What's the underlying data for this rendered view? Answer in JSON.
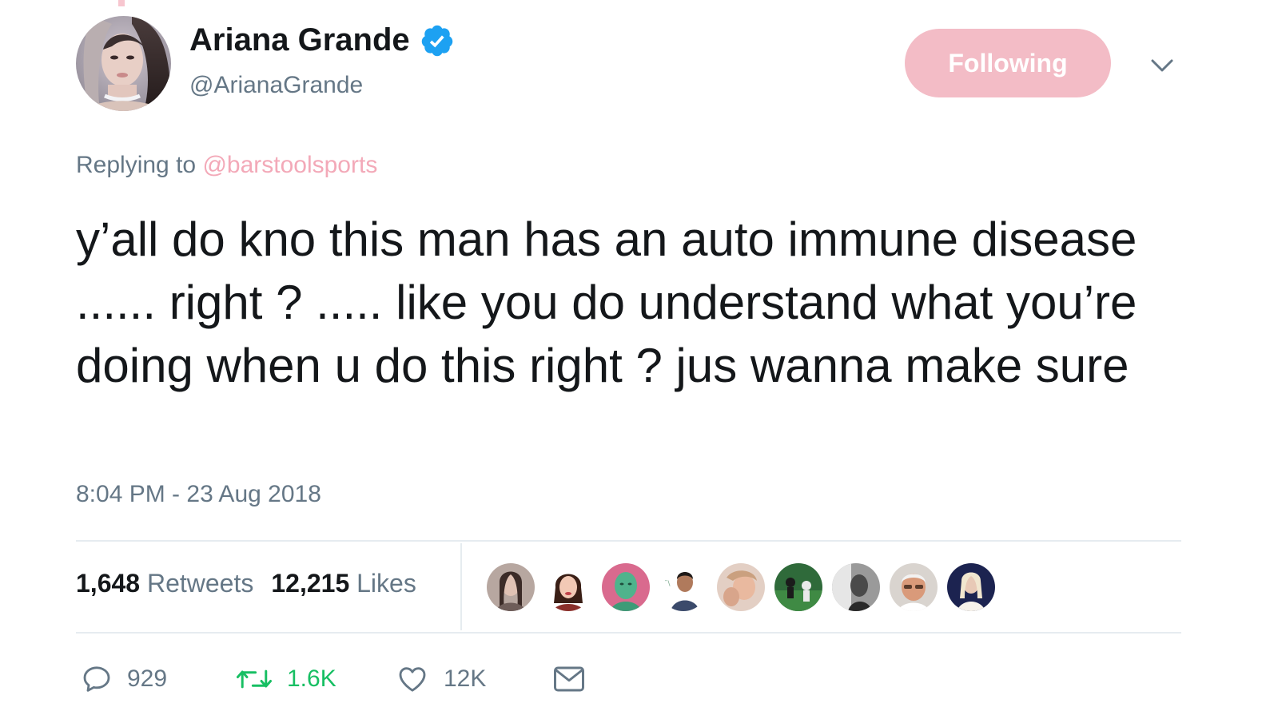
{
  "tweet": {
    "author": {
      "display_name": "Ariana Grande",
      "handle": "@ArianaGrande",
      "verified": true
    },
    "follow_button_label": "Following",
    "replying_prefix": "Replying to",
    "replying_mention": "@barstoolsports",
    "text": "y’all do kno this man has an auto immune disease ...... right ? ..... like you do understand what you’re doing when u do this right ? jus wanna make sure",
    "timestamp": "8:04 PM - 23 Aug 2018",
    "stats": {
      "retweets_count": "1,648",
      "retweets_label": "Retweets",
      "likes_count": "12,215",
      "likes_label": "Likes"
    },
    "actions": {
      "reply_count": "929",
      "retweet_count": "1.6K",
      "like_count": "12K"
    }
  },
  "colors": {
    "brand_pink": "#f3bcc6",
    "mention_pink": "#f3a9b8",
    "verified_blue": "#1da1f2",
    "retweet_green": "#17bf63",
    "muted_gray": "#657786"
  },
  "icons": {
    "verified": "verified-badge-icon",
    "caret": "chevron-down-icon",
    "reply": "speech-bubble-icon",
    "retweet": "retweet-arrows-icon",
    "like": "heart-icon",
    "dm": "envelope-icon"
  }
}
